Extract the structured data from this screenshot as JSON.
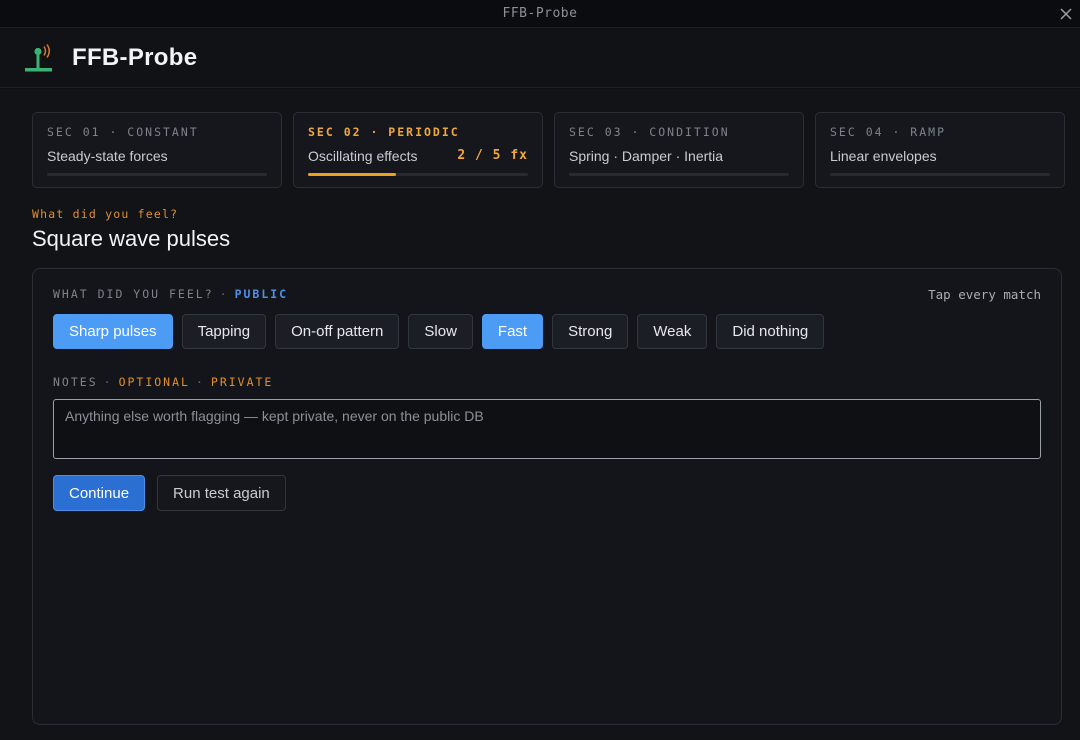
{
  "window": {
    "title": "FFB-Probe"
  },
  "header": {
    "app_name": "FFB-Probe",
    "logo_icon": "joystick-signal-icon"
  },
  "sections": [
    {
      "label": "SEC 01 · CONSTANT",
      "description": "Steady-state forces",
      "progress": 0,
      "count": ""
    },
    {
      "label": "SEC 02 · PERIODIC",
      "description": "Oscillating effects",
      "progress": 0.4,
      "count": "2 / 5 fx",
      "active": true
    },
    {
      "label": "SEC 03 · CONDITION",
      "description": "Spring · Damper · Inertia",
      "progress": 0,
      "count": ""
    },
    {
      "label": "SEC 04 · RAMP",
      "description": "Linear envelopes",
      "progress": 0,
      "count": ""
    }
  ],
  "prompt": {
    "kicker": "What did you feel?",
    "title": "Square wave pulses"
  },
  "feel": {
    "label": "WHAT DID YOU FEEL?",
    "separator": "·",
    "visibility": "PUBLIC",
    "hint": "Tap every match",
    "options": [
      {
        "label": "Sharp pulses",
        "selected": true
      },
      {
        "label": "Tapping",
        "selected": false
      },
      {
        "label": "On-off pattern",
        "selected": false
      },
      {
        "label": "Slow",
        "selected": false
      },
      {
        "label": "Fast",
        "selected": true
      },
      {
        "label": "Strong",
        "selected": false
      },
      {
        "label": "Weak",
        "selected": false
      },
      {
        "label": "Did nothing",
        "selected": false
      }
    ]
  },
  "notes": {
    "label": "NOTES",
    "separator": "·",
    "optional": "OPTIONAL",
    "private": "PRIVATE",
    "placeholder": "Anything else worth flagging — kept private, never on the public DB",
    "value": ""
  },
  "actions": {
    "continue_label": "Continue",
    "rerun_label": "Run test again"
  },
  "colors": {
    "accent_blue": "#4c9bf5",
    "accent_orange": "#f0a020",
    "background": "#111317"
  }
}
